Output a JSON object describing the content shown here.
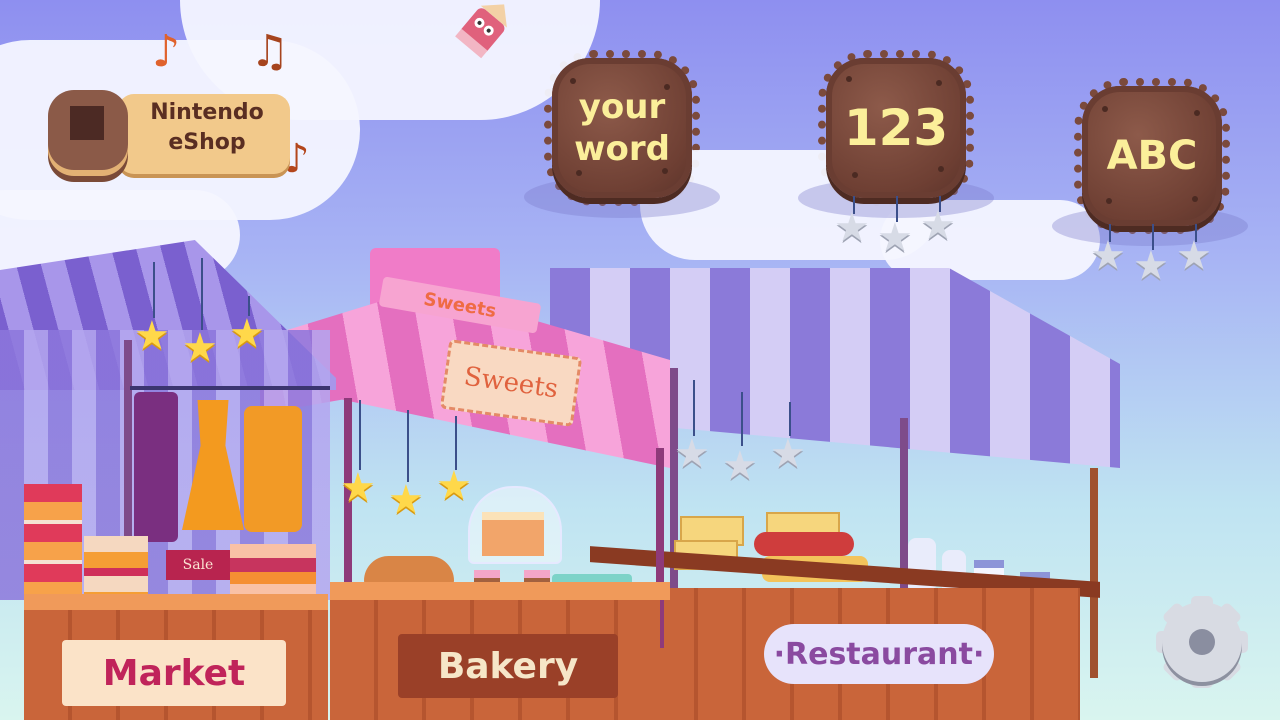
{
  "eshop": {
    "line1": "Nintendo",
    "line2": "eShop"
  },
  "menu": {
    "your_word": {
      "line1": "your",
      "line2": "word"
    },
    "numbers": "123",
    "letters": "ABC"
  },
  "stalls": {
    "market": "Market",
    "bakery": "Bakery",
    "restaurant": "·Restaurant·",
    "sweets_banner": "Sweets",
    "sweets_sign": "Sweets",
    "sale_tag": "Sale"
  },
  "colors": {
    "cookie_text": "#fbef9a",
    "market_text": "#c0245a",
    "bakery_text": "#f6e6c8",
    "restaurant_text": "#8a4aa0"
  },
  "icons": {
    "music": "music-note-icon",
    "settings": "gear-icon",
    "star_earned": "gold-star-icon",
    "star_empty": "gray-star-icon"
  }
}
